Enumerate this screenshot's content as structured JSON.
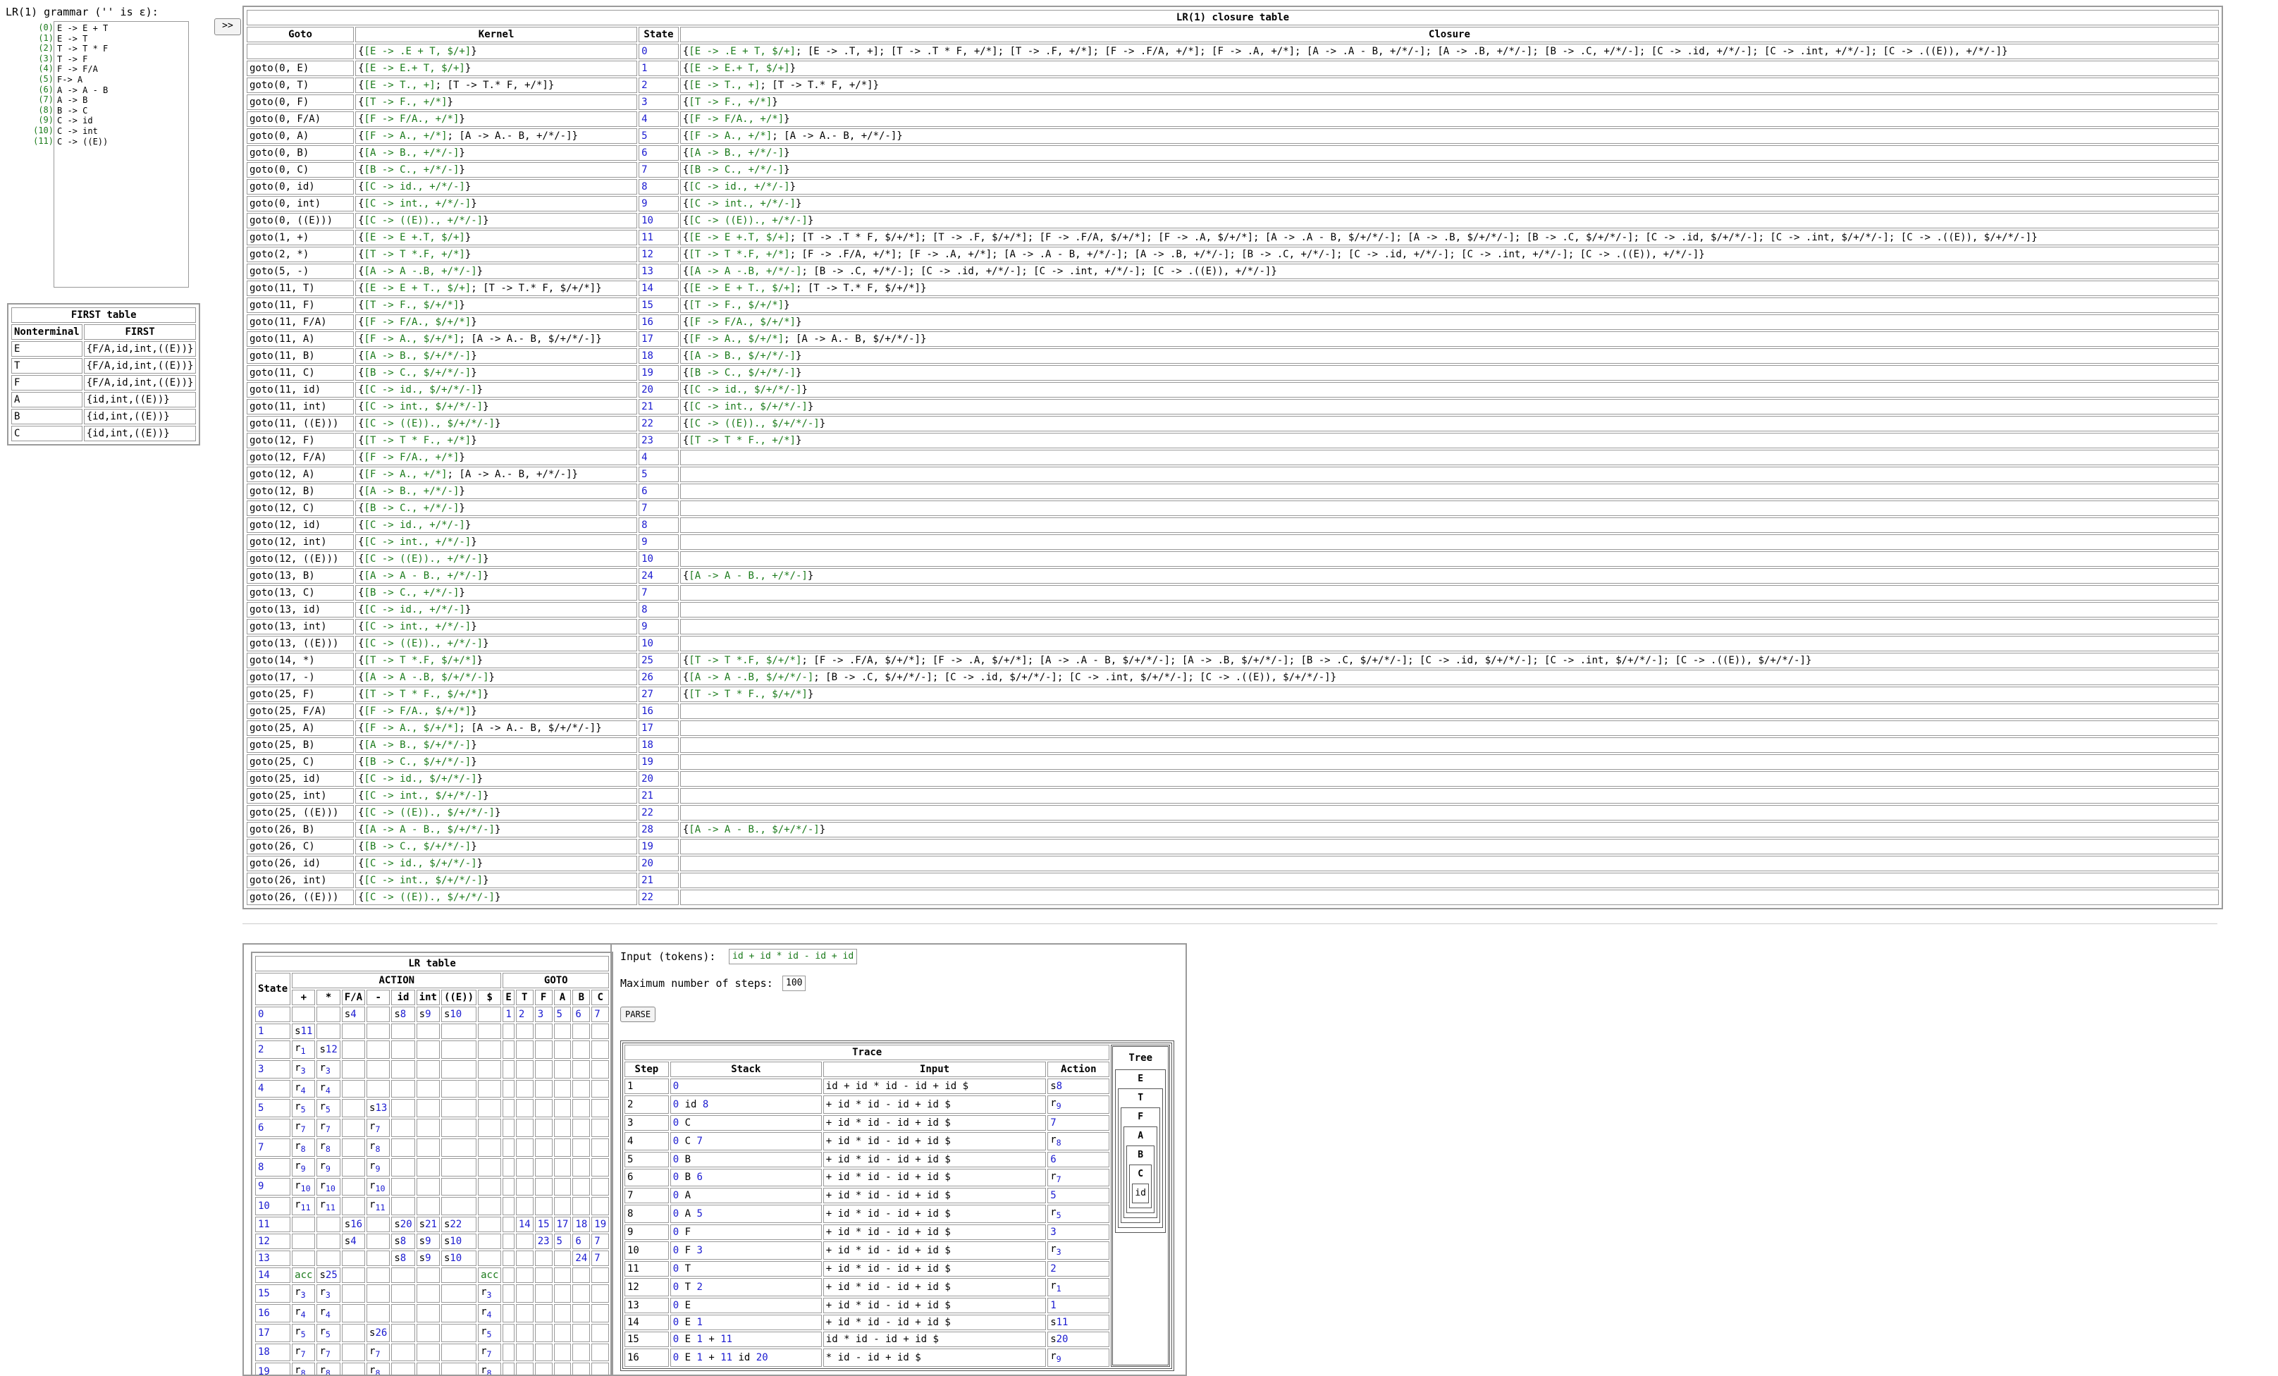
{
  "grammar": {
    "label": "LR(1) grammar ('' is ε):",
    "numbers": [
      "(0)",
      "(1)",
      "(2)",
      "(3)",
      "(4)",
      "(5)",
      "(6)",
      "(7)",
      "(8)",
      "(9)",
      "(10)",
      "(11)"
    ],
    "rules": [
      "E -> E + T",
      "E -> T",
      "T -> T * F",
      "T -> F",
      "F -> F/A",
      "F-> A",
      "A -> A - B",
      "A -> B",
      "B -> C",
      "C -> id",
      "C -> int",
      "C -> ((E))"
    ],
    "toggle_label": ">>"
  },
  "first_table": {
    "title": "FIRST table",
    "headers": [
      "Nonterminal",
      "FIRST"
    ],
    "rows": [
      [
        "E",
        "{F/A,id,int,((E))}"
      ],
      [
        "T",
        "{F/A,id,int,((E))}"
      ],
      [
        "F",
        "{F/A,id,int,((E))}"
      ],
      [
        "A",
        "{id,int,((E))}"
      ],
      [
        "B",
        "{id,int,((E))}"
      ],
      [
        "C",
        "{id,int,((E))}"
      ]
    ]
  },
  "closure_table": {
    "title": "LR(1) closure table",
    "headers": [
      "Goto",
      "Kernel",
      "State",
      "Closure"
    ],
    "rows": [
      [
        "",
        "{[E -> .E + T, $/+]}",
        "0",
        "{[E -> .E + T, $/+]; [E -> .T, +]; [T -> .T * F, +/*]; [T -> .F, +/*]; [F -> .F/A, +/*]; [F -> .A, +/*]; [A -> .A - B, +/*/-]; [A -> .B, +/*/-]; [B -> .C, +/*/-]; [C -> .id, +/*/-]; [C -> .int, +/*/-]; [C -> .((E)), +/*/-]}"
      ],
      [
        "goto(0, E)",
        "{[E -> E.+ T, $/+]}",
        "1",
        "{[E -> E.+ T, $/+]}"
      ],
      [
        "goto(0, T)",
        "{[E -> T., +]; [T -> T.* F, +/*]}",
        "2",
        "{[E -> T., +]; [T -> T.* F, +/*]}"
      ],
      [
        "goto(0, F)",
        "{[T -> F., +/*]}",
        "3",
        "{[T -> F., +/*]}"
      ],
      [
        "goto(0, F/A)",
        "{[F -> F/A., +/*]}",
        "4",
        "{[F -> F/A., +/*]}"
      ],
      [
        "goto(0, A)",
        "{[F -> A., +/*]; [A -> A.- B, +/*/-]}",
        "5",
        "{[F -> A., +/*]; [A -> A.- B, +/*/-]}"
      ],
      [
        "goto(0, B)",
        "{[A -> B., +/*/-]}",
        "6",
        "{[A -> B., +/*/-]}"
      ],
      [
        "goto(0, C)",
        "{[B -> C., +/*/-]}",
        "7",
        "{[B -> C., +/*/-]}"
      ],
      [
        "goto(0, id)",
        "{[C -> id., +/*/-]}",
        "8",
        "{[C -> id., +/*/-]}"
      ],
      [
        "goto(0, int)",
        "{[C -> int., +/*/-]}",
        "9",
        "{[C -> int., +/*/-]}"
      ],
      [
        "goto(0, ((E)))",
        "{[C -> ((E))., +/*/-]}",
        "10",
        "{[C -> ((E))., +/*/-]}"
      ],
      [
        "goto(1, +)",
        "{[E -> E +.T, $/+]}",
        "11",
        "{[E -> E +.T, $/+]; [T -> .T * F, $/+/*]; [T -> .F, $/+/*]; [F -> .F/A, $/+/*]; [F -> .A, $/+/*]; [A -> .A - B, $/+/*/-]; [A -> .B, $/+/*/-]; [B -> .C, $/+/*/-]; [C -> .id, $/+/*/-]; [C -> .int, $/+/*/-]; [C -> .((E)), $/+/*/-]}"
      ],
      [
        "goto(2, *)",
        "{[T -> T *.F, +/*]}",
        "12",
        "{[T -> T *.F, +/*]; [F -> .F/A, +/*]; [F -> .A, +/*]; [A -> .A - B, +/*/-]; [A -> .B, +/*/-]; [B -> .C, +/*/-]; [C -> .id, +/*/-]; [C -> .int, +/*/-]; [C -> .((E)), +/*/-]}"
      ],
      [
        "goto(5, -)",
        "{[A -> A -.B, +/*/-]}",
        "13",
        "{[A -> A -.B, +/*/-]; [B -> .C, +/*/-]; [C -> .id, +/*/-]; [C -> .int, +/*/-]; [C -> .((E)), +/*/-]}"
      ],
      [
        "goto(11, T)",
        "{[E -> E + T., $/+]; [T -> T.* F, $/+/*]}",
        "14",
        "{[E -> E + T., $/+]; [T -> T.* F, $/+/*]}"
      ],
      [
        "goto(11, F)",
        "{[T -> F., $/+/*]}",
        "15",
        "{[T -> F., $/+/*]}"
      ],
      [
        "goto(11, F/A)",
        "{[F -> F/A., $/+/*]}",
        "16",
        "{[F -> F/A., $/+/*]}"
      ],
      [
        "goto(11, A)",
        "{[F -> A., $/+/*]; [A -> A.- B, $/+/*/-]}",
        "17",
        "{[F -> A., $/+/*]; [A -> A.- B, $/+/*/-]}"
      ],
      [
        "goto(11, B)",
        "{[A -> B., $/+/*/-]}",
        "18",
        "{[A -> B., $/+/*/-]}"
      ],
      [
        "goto(11, C)",
        "{[B -> C., $/+/*/-]}",
        "19",
        "{[B -> C., $/+/*/-]}"
      ],
      [
        "goto(11, id)",
        "{[C -> id., $/+/*/-]}",
        "20",
        "{[C -> id., $/+/*/-]}"
      ],
      [
        "goto(11, int)",
        "{[C -> int., $/+/*/-]}",
        "21",
        "{[C -> int., $/+/*/-]}"
      ],
      [
        "goto(11, ((E)))",
        "{[C -> ((E))., $/+/*/-]}",
        "22",
        "{[C -> ((E))., $/+/*/-]}"
      ],
      [
        "goto(12, F)",
        "{[T -> T * F., +/*]}",
        "23",
        "{[T -> T * F., +/*]}"
      ],
      [
        "goto(12, F/A)",
        "{[F -> F/A., +/*]}",
        "4",
        ""
      ],
      [
        "goto(12, A)",
        "{[F -> A., +/*]; [A -> A.- B, +/*/-]}",
        "5",
        ""
      ],
      [
        "goto(12, B)",
        "{[A -> B., +/*/-]}",
        "6",
        ""
      ],
      [
        "goto(12, C)",
        "{[B -> C., +/*/-]}",
        "7",
        ""
      ],
      [
        "goto(12, id)",
        "{[C -> id., +/*/-]}",
        "8",
        ""
      ],
      [
        "goto(12, int)",
        "{[C -> int., +/*/-]}",
        "9",
        ""
      ],
      [
        "goto(12, ((E)))",
        "{[C -> ((E))., +/*/-]}",
        "10",
        ""
      ],
      [
        "goto(13, B)",
        "{[A -> A - B., +/*/-]}",
        "24",
        "{[A -> A - B., +/*/-]}"
      ],
      [
        "goto(13, C)",
        "{[B -> C., +/*/-]}",
        "7",
        ""
      ],
      [
        "goto(13, id)",
        "{[C -> id., +/*/-]}",
        "8",
        ""
      ],
      [
        "goto(13, int)",
        "{[C -> int., +/*/-]}",
        "9",
        ""
      ],
      [
        "goto(13, ((E)))",
        "{[C -> ((E))., +/*/-]}",
        "10",
        ""
      ],
      [
        "goto(14, *)",
        "{[T -> T *.F, $/+/*]}",
        "25",
        "{[T -> T *.F, $/+/*]; [F -> .F/A, $/+/*]; [F -> .A, $/+/*]; [A -> .A - B, $/+/*/-]; [A -> .B, $/+/*/-]; [B -> .C, $/+/*/-]; [C -> .id, $/+/*/-]; [C -> .int, $/+/*/-]; [C -> .((E)), $/+/*/-]}"
      ],
      [
        "goto(17, -)",
        "{[A -> A -.B, $/+/*/-]}",
        "26",
        "{[A -> A -.B, $/+/*/-]; [B -> .C, $/+/*/-]; [C -> .id, $/+/*/-]; [C -> .int, $/+/*/-]; [C -> .((E)), $/+/*/-]}"
      ],
      [
        "goto(25, F)",
        "{[T -> T * F., $/+/*]}",
        "27",
        "{[T -> T * F., $/+/*]}"
      ],
      [
        "goto(25, F/A)",
        "{[F -> F/A., $/+/*]}",
        "16",
        ""
      ],
      [
        "goto(25, A)",
        "{[F -> A., $/+/*]; [A -> A.- B, $/+/*/-]}",
        "17",
        ""
      ],
      [
        "goto(25, B)",
        "{[A -> B., $/+/*/-]}",
        "18",
        ""
      ],
      [
        "goto(25, C)",
        "{[B -> C., $/+/*/-]}",
        "19",
        ""
      ],
      [
        "goto(25, id)",
        "{[C -> id., $/+/*/-]}",
        "20",
        ""
      ],
      [
        "goto(25, int)",
        "{[C -> int., $/+/*/-]}",
        "21",
        ""
      ],
      [
        "goto(25, ((E)))",
        "{[C -> ((E))., $/+/*/-]}",
        "22",
        ""
      ],
      [
        "goto(26, B)",
        "{[A -> A - B., $/+/*/-]}",
        "28",
        "{[A -> A - B., $/+/*/-]}"
      ],
      [
        "goto(26, C)",
        "{[B -> C., $/+/*/-]}",
        "19",
        ""
      ],
      [
        "goto(26, id)",
        "{[C -> id., $/+/*/-]}",
        "20",
        ""
      ],
      [
        "goto(26, int)",
        "{[C -> int., $/+/*/-]}",
        "21",
        ""
      ],
      [
        "goto(26, ((E)))",
        "{[C -> ((E))., $/+/*/-]}",
        "22",
        ""
      ]
    ]
  },
  "lr_table": {
    "title": "LR table",
    "state_header": "State",
    "action_header": "ACTION",
    "goto_header": "GOTO",
    "action_cols": [
      "+",
      "*",
      "F/A",
      "-",
      "id",
      "int",
      "((E))",
      "$"
    ],
    "goto_cols": [
      "E",
      "T",
      "F",
      "A",
      "B",
      "C"
    ],
    "rows": [
      [
        "0",
        [
          "",
          "",
          "s4",
          "",
          "s8",
          "s9",
          "s10",
          ""
        ],
        [
          "1",
          "2",
          "3",
          "5",
          "6",
          "7"
        ]
      ],
      [
        "1",
        [
          "s11",
          "",
          "",
          "",
          "",
          "",
          "",
          ""
        ],
        [
          "",
          "",
          "",
          "",
          "",
          ""
        ]
      ],
      [
        "2",
        [
          "r1",
          "s12",
          "",
          "",
          "",
          "",
          "",
          ""
        ],
        [
          "",
          "",
          "",
          "",
          "",
          ""
        ]
      ],
      [
        "3",
        [
          "r3",
          "r3",
          "",
          "",
          "",
          "",
          "",
          ""
        ],
        [
          "",
          "",
          "",
          "",
          "",
          ""
        ]
      ],
      [
        "4",
        [
          "r4",
          "r4",
          "",
          "",
          "",
          "",
          "",
          ""
        ],
        [
          "",
          "",
          "",
          "",
          "",
          ""
        ]
      ],
      [
        "5",
        [
          "r5",
          "r5",
          "",
          "s13",
          "",
          "",
          "",
          ""
        ],
        [
          "",
          "",
          "",
          "",
          "",
          ""
        ]
      ],
      [
        "6",
        [
          "r7",
          "r7",
          "",
          "r7",
          "",
          "",
          "",
          ""
        ],
        [
          "",
          "",
          "",
          "",
          "",
          ""
        ]
      ],
      [
        "7",
        [
          "r8",
          "r8",
          "",
          "r8",
          "",
          "",
          "",
          ""
        ],
        [
          "",
          "",
          "",
          "",
          "",
          ""
        ]
      ],
      [
        "8",
        [
          "r9",
          "r9",
          "",
          "r9",
          "",
          "",
          "",
          ""
        ],
        [
          "",
          "",
          "",
          "",
          "",
          ""
        ]
      ],
      [
        "9",
        [
          "r10",
          "r10",
          "",
          "r10",
          "",
          "",
          "",
          ""
        ],
        [
          "",
          "",
          "",
          "",
          "",
          ""
        ]
      ],
      [
        "10",
        [
          "r11",
          "r11",
          "",
          "r11",
          "",
          "",
          "",
          ""
        ],
        [
          "",
          "",
          "",
          "",
          "",
          ""
        ]
      ],
      [
        "11",
        [
          "",
          "",
          "s16",
          "",
          "s20",
          "s21",
          "s22",
          ""
        ],
        [
          "",
          "14",
          "15",
          "17",
          "18",
          "19"
        ]
      ],
      [
        "12",
        [
          "",
          "",
          "s4",
          "",
          "s8",
          "s9",
          "s10",
          ""
        ],
        [
          "",
          "",
          "23",
          "5",
          "6",
          "7"
        ]
      ],
      [
        "13",
        [
          "",
          "",
          "",
          "",
          "s8",
          "s9",
          "s10",
          ""
        ],
        [
          "",
          "",
          "",
          "",
          "24",
          "7"
        ]
      ],
      [
        "14",
        [
          "acc",
          "s25",
          "",
          "",
          "",
          "",
          "",
          "acc"
        ],
        [
          "",
          "",
          "",
          "",
          "",
          ""
        ]
      ],
      [
        "15",
        [
          "r3",
          "r3",
          "",
          "",
          "",
          "",
          "",
          "r3"
        ],
        [
          "",
          "",
          "",
          "",
          "",
          ""
        ]
      ],
      [
        "16",
        [
          "r4",
          "r4",
          "",
          "",
          "",
          "",
          "",
          "r4"
        ],
        [
          "",
          "",
          "",
          "",
          "",
          ""
        ]
      ],
      [
        "17",
        [
          "r5",
          "r5",
          "",
          "s26",
          "",
          "",
          "",
          "r5"
        ],
        [
          "",
          "",
          "",
          "",
          "",
          ""
        ]
      ],
      [
        "18",
        [
          "r7",
          "r7",
          "",
          "r7",
          "",
          "",
          "",
          "r7"
        ],
        [
          "",
          "",
          "",
          "",
          "",
          ""
        ]
      ],
      [
        "19",
        [
          "r8",
          "r8",
          "",
          "r8",
          "",
          "",
          "",
          "r8"
        ],
        [
          "",
          "",
          "",
          "",
          "",
          ""
        ]
      ]
    ]
  },
  "parser": {
    "input_label": "Input (tokens):",
    "input_value": "id + id * id - id + id",
    "max_steps_label": "Maximum number of steps:",
    "max_steps_value": "100",
    "parse_button": "PARSE"
  },
  "trace": {
    "title": "Trace",
    "headers": [
      "Step",
      "Stack",
      "Input",
      "Action"
    ],
    "tree_header": "Tree",
    "tree_nodes": [
      "E",
      "T",
      "F",
      "A",
      "B",
      "C",
      "id"
    ],
    "rows": [
      [
        "1",
        "0",
        "id + id * id - id + id $",
        "s8"
      ],
      [
        "2",
        "0 id 8",
        "+ id * id - id + id $",
        "r9"
      ],
      [
        "3",
        "0 C",
        "+ id * id - id + id $",
        "7"
      ],
      [
        "4",
        "0 C 7",
        "+ id * id - id + id $",
        "r8"
      ],
      [
        "5",
        "0 B",
        "+ id * id - id + id $",
        "6"
      ],
      [
        "6",
        "0 B 6",
        "+ id * id - id + id $",
        "r7"
      ],
      [
        "7",
        "0 A",
        "+ id * id - id + id $",
        "5"
      ],
      [
        "8",
        "0 A 5",
        "+ id * id - id + id $",
        "r5"
      ],
      [
        "9",
        "0 F",
        "+ id * id - id + id $",
        "3"
      ],
      [
        "10",
        "0 F 3",
        "+ id * id - id + id $",
        "r3"
      ],
      [
        "11",
        "0 T",
        "+ id * id - id + id $",
        "2"
      ],
      [
        "12",
        "0 T 2",
        "+ id * id - id + id $",
        "r1"
      ],
      [
        "13",
        "0 E",
        "+ id * id - id + id $",
        "1"
      ],
      [
        "14",
        "0 E 1",
        "+ id * id - id + id $",
        "s11"
      ],
      [
        "15",
        "0 E 1 + 11",
        "id * id - id + id $",
        "s20"
      ],
      [
        "16",
        "0 E 1 + 11 id 20",
        "* id - id + id $",
        "r9"
      ]
    ]
  }
}
